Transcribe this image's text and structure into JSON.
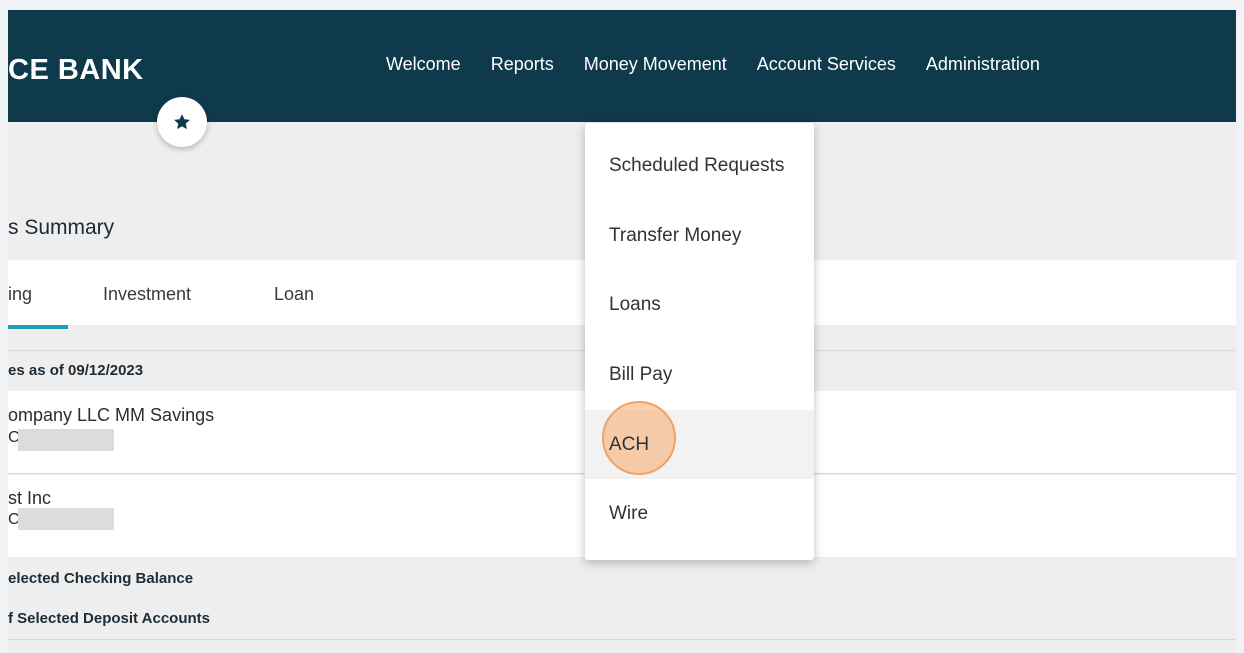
{
  "header": {
    "brand": "CE BANK",
    "nav": [
      "Welcome",
      "Reports",
      "Money Movement",
      "Account Services",
      "Administration"
    ]
  },
  "favorites_icon": "star-icon",
  "page": {
    "title": "s Summary",
    "tabs": [
      "ing",
      "Investment",
      "Loan"
    ],
    "active_tab": "ing",
    "balances_as_of": "es as of 09/12/2023",
    "accounts": [
      {
        "name": "ompany LLC MM Savings",
        "sub": "C"
      },
      {
        "name": "st Inc",
        "sub": "C"
      }
    ],
    "summary_rows": [
      "elected Checking Balance",
      "f Selected Deposit Accounts"
    ]
  },
  "dropdown": {
    "items": [
      "Scheduled Requests",
      "Transfer Money",
      "Loans",
      "Bill Pay",
      "ACH",
      "Wire"
    ],
    "highlighted": "ACH"
  },
  "colors": {
    "header_bg": "#0e3a4c",
    "tab_accent": "#1e9fb7",
    "click_marker": "#f0a262"
  }
}
